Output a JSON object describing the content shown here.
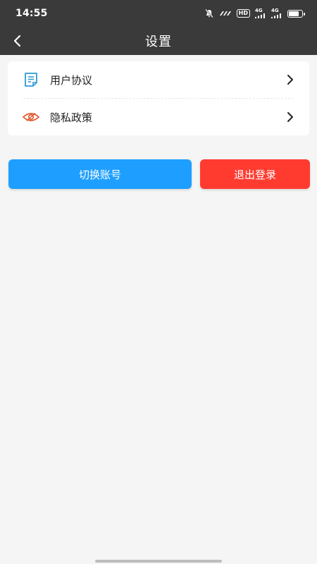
{
  "status_bar": {
    "time": "14:55",
    "icons": [
      "mute-icon",
      "network-speed-icon",
      "hd-icon",
      "signal-4g-icon",
      "signal-4g-icon",
      "battery-icon"
    ],
    "hd_label": "HD",
    "net4g_label_1": "4G",
    "net4g_label_2": "4G",
    "battery_level": 0.8
  },
  "nav": {
    "title": "设置",
    "back_icon": "chevron-left-icon"
  },
  "menu": {
    "items": [
      {
        "label": "用户协议",
        "icon": "document-icon",
        "icon_color": "#2d9bd6"
      },
      {
        "label": "隐私政策",
        "icon": "eye-icon",
        "icon_color": "#e2542a"
      }
    ]
  },
  "actions": {
    "switch_account": "切换账号",
    "logout": "退出登录"
  },
  "colors": {
    "header_bg": "#3a3a3a",
    "switch_button": "#1e9fff",
    "logout_button": "#ff3b30",
    "page_bg": "#f5f5f5"
  }
}
